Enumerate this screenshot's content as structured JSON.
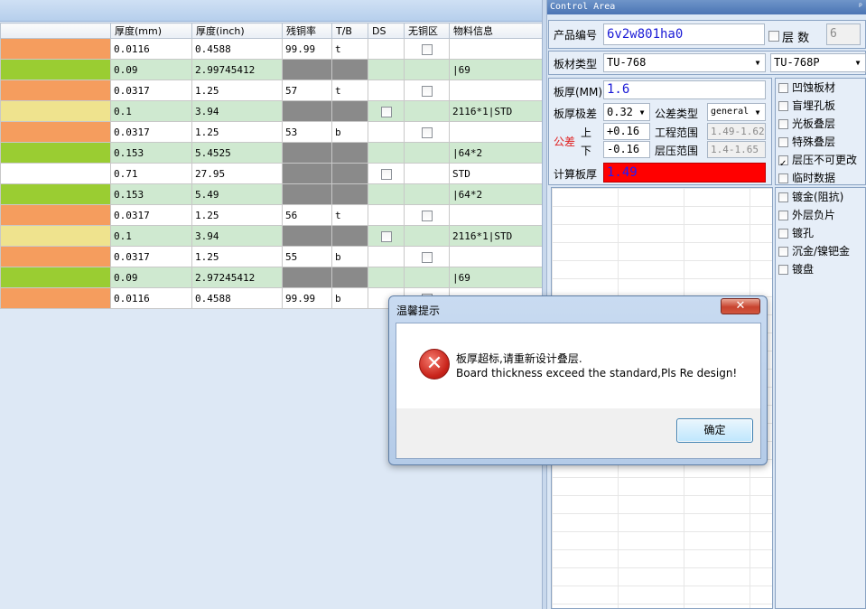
{
  "grid": {
    "headers": [
      "",
      "厚度(mm)",
      "厚度(inch)",
      "残铜率",
      "T/B",
      "DS",
      "无铜区",
      "物料信息"
    ],
    "rows": [
      {
        "color": "#f59d5e",
        "mm": "0.0116",
        "inch": "0.4588",
        "cu": "99.99",
        "tb": "t",
        "ds": false,
        "nocu": true,
        "mat": "",
        "green": false,
        "gray": false
      },
      {
        "color": "#9acd32",
        "mm": "0.09",
        "inch": "2.99745412",
        "cu": "",
        "tb": "",
        "ds": false,
        "nocu": false,
        "mat": "|69",
        "green": true,
        "gray": true
      },
      {
        "color": "#f59d5e",
        "mm": "0.0317",
        "inch": "1.25",
        "cu": "57",
        "tb": "t",
        "ds": false,
        "nocu": true,
        "mat": "",
        "green": false,
        "gray": false
      },
      {
        "color": "#efe38e",
        "mm": "0.1",
        "inch": "3.94",
        "cu": "",
        "tb": "",
        "ds": true,
        "nocu": false,
        "mat": "2116*1|STD",
        "green": true,
        "gray": true
      },
      {
        "color": "#f59d5e",
        "mm": "0.0317",
        "inch": "1.25",
        "cu": "53",
        "tb": "b",
        "ds": false,
        "nocu": true,
        "mat": "",
        "green": false,
        "gray": false
      },
      {
        "color": "#9acd32",
        "mm": "0.153",
        "inch": "5.4525",
        "cu": "",
        "tb": "",
        "ds": false,
        "nocu": false,
        "mat": "|64*2",
        "green": true,
        "gray": true
      },
      {
        "color": "#ffffff",
        "mm": "0.71",
        "inch": "27.95",
        "cu": "",
        "tb": "",
        "ds": true,
        "nocu": false,
        "mat": "STD",
        "green": false,
        "gray": true
      },
      {
        "color": "#9acd32",
        "mm": "0.153",
        "inch": "5.49",
        "cu": "",
        "tb": "",
        "ds": false,
        "nocu": false,
        "mat": "|64*2",
        "green": true,
        "gray": true
      },
      {
        "color": "#f59d5e",
        "mm": "0.0317",
        "inch": "1.25",
        "cu": "56",
        "tb": "t",
        "ds": false,
        "nocu": true,
        "mat": "",
        "green": false,
        "gray": false
      },
      {
        "color": "#efe38e",
        "mm": "0.1",
        "inch": "3.94",
        "cu": "",
        "tb": "",
        "ds": true,
        "nocu": false,
        "mat": "2116*1|STD",
        "green": true,
        "gray": true
      },
      {
        "color": "#f59d5e",
        "mm": "0.0317",
        "inch": "1.25",
        "cu": "55",
        "tb": "b",
        "ds": false,
        "nocu": true,
        "mat": "",
        "green": false,
        "gray": false
      },
      {
        "color": "#9acd32",
        "mm": "0.09",
        "inch": "2.97245412",
        "cu": "",
        "tb": "",
        "ds": false,
        "nocu": false,
        "mat": "|69",
        "green": true,
        "gray": true
      },
      {
        "color": "#f59d5e",
        "mm": "0.0116",
        "inch": "0.4588",
        "cu": "99.99",
        "tb": "b",
        "ds": false,
        "nocu": true,
        "mat": "",
        "green": false,
        "gray": false
      }
    ]
  },
  "control": {
    "title": "Control Area",
    "pin": "ᵖ",
    "product_label": "产品编号",
    "product_value": "6v2w801ha0",
    "layers_label": "层 数",
    "layers_value": "6",
    "board_type_label": "板材类型",
    "board_type_value": "TU-768",
    "board_type_value2": "TU-768P",
    "thickness_label": "板厚(MM)",
    "thickness_value": "1.6",
    "tol_grade_label": "板厚极差",
    "tol_grade_value": "0.32",
    "tol_type_label": "公差类型",
    "tol_type_value": "general",
    "tol_label": "公差",
    "upper_label": "上",
    "upper_value": "+0.16",
    "lower_label": "下",
    "lower_value": "-0.16",
    "eng_range_label": "工程范围",
    "eng_range_value": "1.49-1.62",
    "press_range_label": "层压范围",
    "press_range_value": "1.4-1.65",
    "calc_label": "计算板厚",
    "calc_value": "1.49",
    "options_top": [
      {
        "label": "凹蚀板材",
        "checked": false
      },
      {
        "label": "盲埋孔板",
        "checked": false
      },
      {
        "label": "光板叠层",
        "checked": false
      },
      {
        "label": "特殊叠层",
        "checked": false
      },
      {
        "label": "层压不可更改",
        "checked": true
      },
      {
        "label": "临时数据",
        "checked": false
      }
    ],
    "options_bottom": [
      {
        "label": "镀金(阻抗)",
        "checked": false
      },
      {
        "label": "外层负片",
        "checked": false
      },
      {
        "label": "镀孔",
        "checked": false
      },
      {
        "label": "沉金/镍钯金",
        "checked": false
      },
      {
        "label": "镀盘",
        "checked": false
      }
    ]
  },
  "dialog": {
    "title": "温馨提示",
    "close": "✕",
    "message_cn": "板厚超标,请重新设计叠层.",
    "message_en": "Board thickness exceed the standard,Pls Re design!",
    "ok": "确定",
    "icon": "✕"
  },
  "colors": {
    "orange": "#f59d5e",
    "green": "#9acd32",
    "yellow": "#efe38e",
    "calc_bg": "#ff0000",
    "calc_fg": "#1c1cff",
    "tol_red": "#e02020"
  }
}
